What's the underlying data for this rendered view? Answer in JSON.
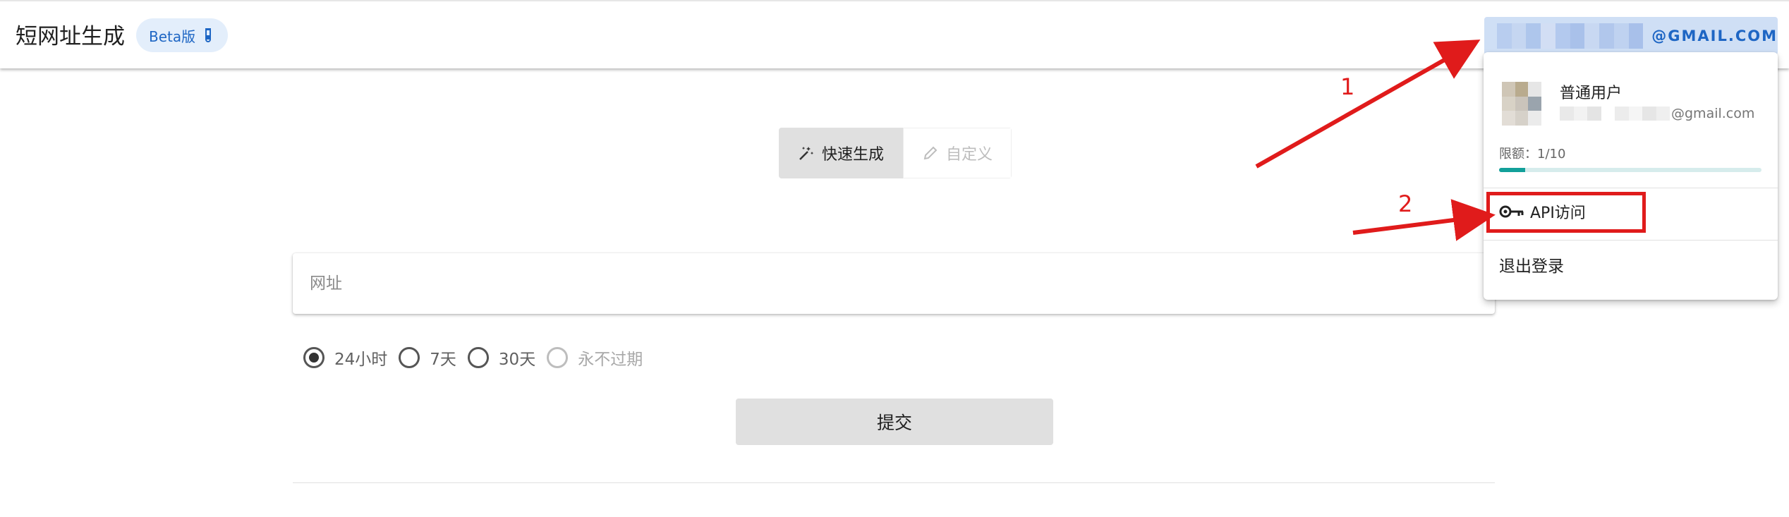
{
  "header": {
    "app_title": "短网址生成",
    "beta_label": "Beta版",
    "account_email": "@GMAIL.COM"
  },
  "mode_tabs": [
    {
      "label": "快速生成",
      "icon": "magic-wand-icon",
      "active": true
    },
    {
      "label": "自定义",
      "icon": "pencil-icon",
      "active": false
    }
  ],
  "form": {
    "url_placeholder": "网址",
    "url_value": "",
    "expiry_options": [
      {
        "label": "24小时",
        "checked": true,
        "disabled": false
      },
      {
        "label": "7天",
        "checked": false,
        "disabled": false
      },
      {
        "label": "30天",
        "checked": false,
        "disabled": false
      },
      {
        "label": "永不过期",
        "checked": false,
        "disabled": true
      }
    ],
    "submit_label": "提交"
  },
  "account_menu": {
    "role": "普通用户",
    "email": "@gmail.com",
    "quota_label": "限额：1/10",
    "quota_used": 1,
    "quota_total": 10,
    "api_item": {
      "label": "API访问",
      "icon": "key-icon"
    },
    "logout_label": "退出登录"
  },
  "annotations": {
    "step1": "1",
    "step2": "2",
    "color": "#e01b1b"
  },
  "colors": {
    "accent_blue": "#1e66c4",
    "chip_bg": "#e3eefb",
    "quota_fill": "#12a09a"
  }
}
